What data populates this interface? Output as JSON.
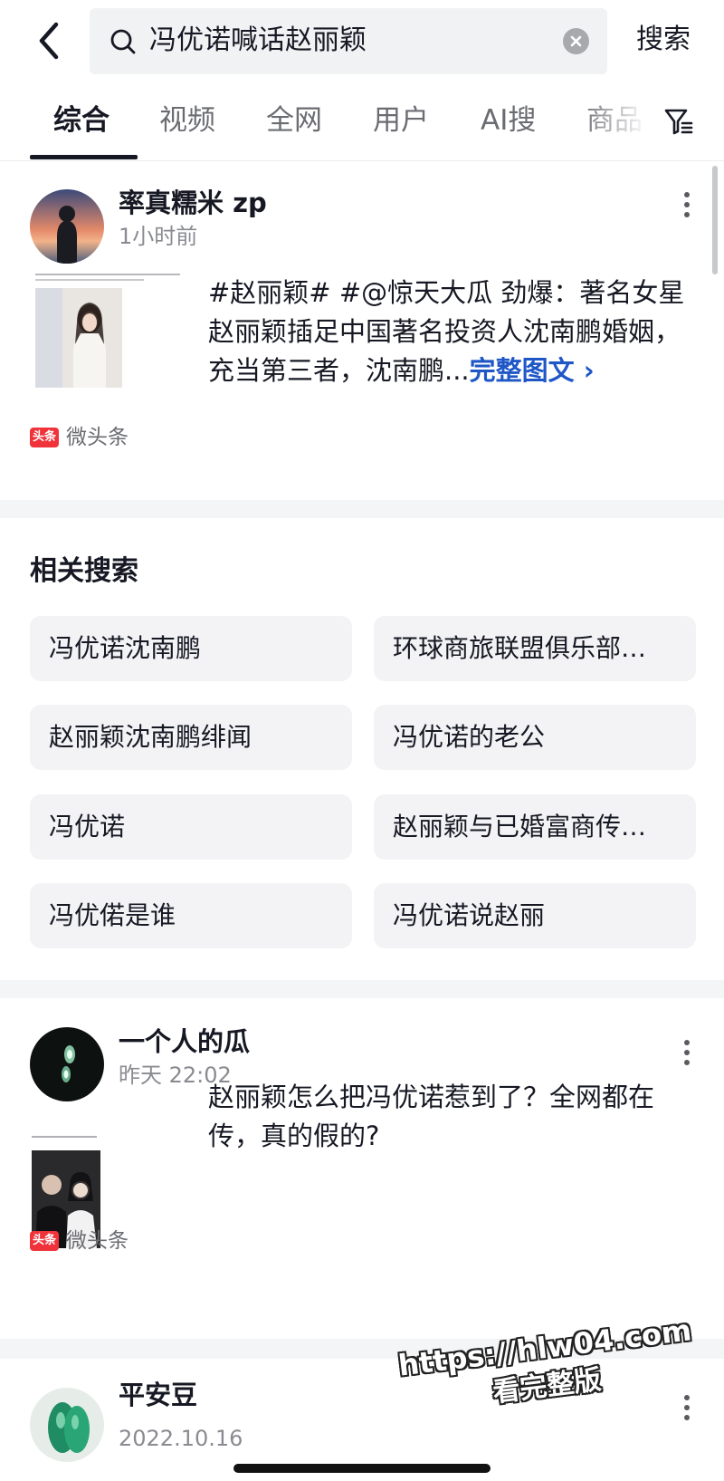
{
  "header": {
    "search_query": "冯优诺喊话赵丽颖",
    "search_button": "搜索"
  },
  "tabs": [
    {
      "label": "综合",
      "active": true
    },
    {
      "label": "视频",
      "active": false
    },
    {
      "label": "全网",
      "active": false
    },
    {
      "label": "用户",
      "active": false
    },
    {
      "label": "AI搜",
      "active": false
    },
    {
      "label": "商品",
      "active": false
    }
  ],
  "posts": [
    {
      "author": "率真糯米 zp",
      "time": "1小时前",
      "text": "#赵丽颖# #@惊天大瓜 劲爆：著名女星赵丽颖插足中国著名投资人沈南鹏婚姻，充当第三者，沈南鹏...",
      "more_link": "完整图文 ›",
      "source_badge": "头条",
      "source": "微头条"
    },
    {
      "author": "一个人的瓜",
      "time": "昨天 22:02",
      "text": "赵丽颖怎么把冯优诺惹到了？全网都在传，真的假的?",
      "source_badge": "头条",
      "source": "微头条"
    },
    {
      "author": "平安豆",
      "time": "2022.10.16"
    }
  ],
  "related": {
    "title": "相关搜索",
    "items": [
      "冯优诺沈南鹏",
      "环球商旅联盟俱乐部…",
      "赵丽颖沈南鹏绯闻",
      "冯优诺的老公",
      "冯优诺",
      "赵丽颖与已婚富商传…",
      "冯优偌是谁",
      "冯优诺说赵丽"
    ]
  },
  "watermark": {
    "line1": "https://hlw04.com",
    "line2": "看完整版"
  },
  "colors": {
    "accent_link": "#1f57c7",
    "source_badge": "#f0323a",
    "chip_bg": "#f3f3f5",
    "section_gap": "#f4f5f7"
  },
  "icons": [
    "back-arrow-icon",
    "search-icon",
    "clear-icon",
    "filter-icon",
    "more-icon"
  ]
}
